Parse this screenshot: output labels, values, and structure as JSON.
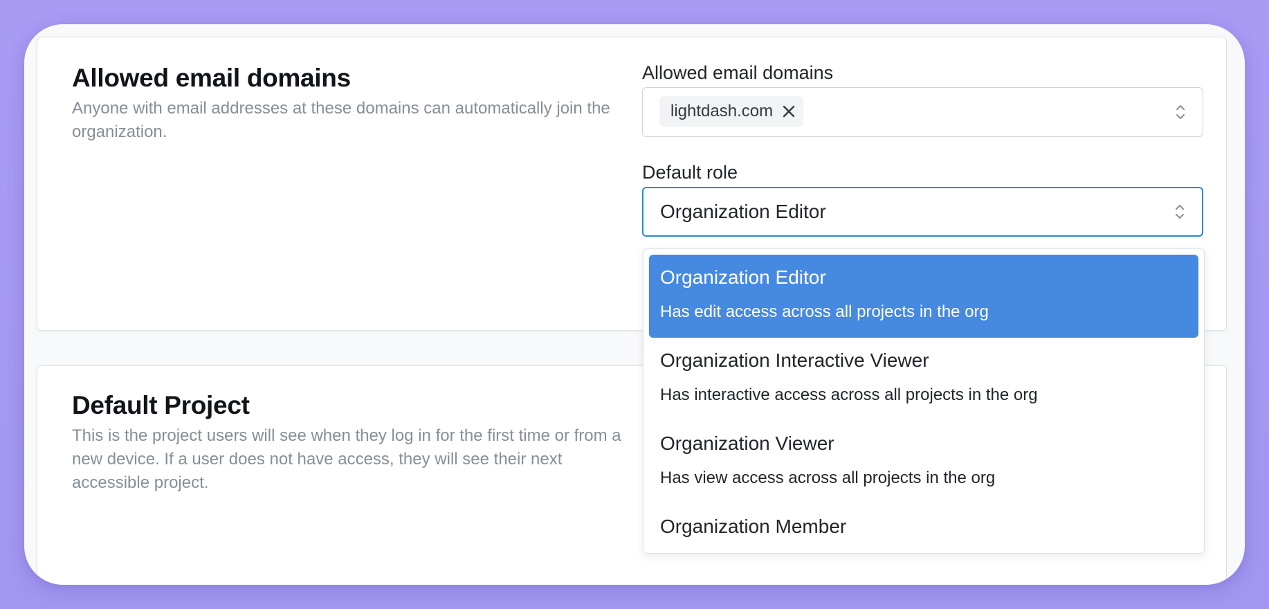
{
  "sections": {
    "allowed_domains": {
      "title": "Allowed email domains",
      "description": "Anyone with email addresses at these domains can automatically join the organization."
    },
    "default_project": {
      "title": "Default Project",
      "description": "This is the project users will see when they log in for the first time or from a new device. If a user does not have access, they will see their next accessible project."
    }
  },
  "form": {
    "domains_label": "Allowed email domains",
    "domains": [
      "lightdash.com"
    ],
    "role_label": "Default role",
    "role_value": "Organization Editor"
  },
  "dropdown": {
    "options": [
      {
        "title": "Organization Editor",
        "description": "Has edit access across all projects in the org",
        "selected": true
      },
      {
        "title": "Organization Interactive Viewer",
        "description": "Has interactive access across all projects in the org",
        "selected": false
      },
      {
        "title": "Organization Viewer",
        "description": "Has view access across all projects in the org",
        "selected": false
      },
      {
        "title": "Organization Member",
        "description": "",
        "selected": false
      }
    ]
  },
  "colors": {
    "background": "#a99bf4",
    "accent": "#4589e0",
    "focus_border": "#228be6"
  },
  "icons": {
    "remove_tag": "close-icon",
    "select_indicator": "chevron-up-down-icon"
  }
}
